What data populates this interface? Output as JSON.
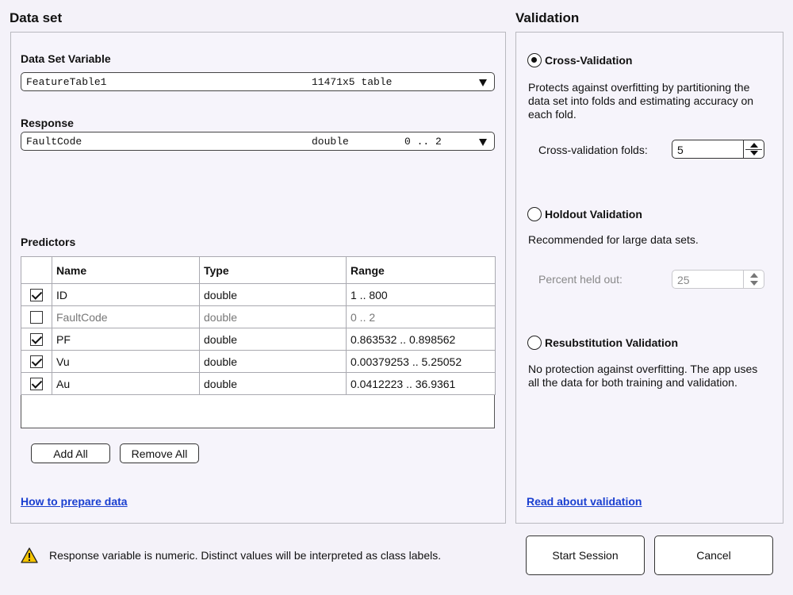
{
  "dataset": {
    "title": "Data set",
    "variable_label": "Data Set Variable",
    "variable": {
      "name": "FeatureTable1",
      "size": "11471x5 table"
    },
    "response_label": "Response",
    "response": {
      "name": "FaultCode",
      "type": "double",
      "range": "0 .. 2"
    },
    "predictors_label": "Predictors",
    "columns": [
      "Name",
      "Type",
      "Range"
    ],
    "rows": [
      {
        "checked": true,
        "name": "ID",
        "type": "double",
        "range": "1 .. 800"
      },
      {
        "checked": false,
        "name": "FaultCode",
        "type": "double",
        "range": "0 .. 2"
      },
      {
        "checked": true,
        "name": "PF",
        "type": "double",
        "range": "0.863532 .. 0.898562"
      },
      {
        "checked": true,
        "name": "Vu",
        "type": "double",
        "range": "0.00379253 .. 5.25052"
      },
      {
        "checked": true,
        "name": "Au",
        "type": "double",
        "range": "0.0412223 .. 36.9361"
      }
    ],
    "add_all": "Add All",
    "remove_all": "Remove All",
    "help_link": "How to prepare data"
  },
  "validation": {
    "title": "Validation",
    "cross": {
      "label": "Cross-Validation",
      "selected": true,
      "desc": "Protects against overfitting by partitioning the data set into folds and estimating accuracy on each fold.",
      "folds_label": "Cross-validation folds:",
      "folds_value": "5"
    },
    "holdout": {
      "label": "Holdout Validation",
      "selected": false,
      "desc": "Recommended for large data sets.",
      "percent_label": "Percent held out:",
      "percent_value": "25"
    },
    "resub": {
      "label": "Resubstitution Validation",
      "selected": false,
      "desc": "No protection against overfitting. The app uses all the data for both training and validation."
    },
    "help_link": "Read about validation"
  },
  "footer": {
    "warning": "Response variable is numeric. Distinct values will be interpreted as class labels.",
    "warning_icon": "warning-icon",
    "start": "Start Session",
    "cancel": "Cancel"
  }
}
